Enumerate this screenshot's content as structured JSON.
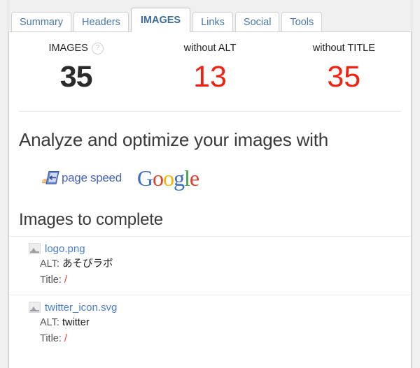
{
  "tabs": [
    {
      "label": "Summary",
      "active": false
    },
    {
      "label": "Headers",
      "active": false
    },
    {
      "label": "IMAGES",
      "active": true
    },
    {
      "label": "Links",
      "active": false
    },
    {
      "label": "Social",
      "active": false
    },
    {
      "label": "Tools",
      "active": false
    }
  ],
  "stats": [
    {
      "label": "IMAGES",
      "value": "35",
      "color": "#2b2b2b",
      "has_help": true,
      "help_glyph": "?"
    },
    {
      "label": "without ALT",
      "value": "13",
      "color": "#f02211",
      "has_help": false
    },
    {
      "label": "without TITLE",
      "value": "35",
      "color": "#f02211",
      "has_help": false
    }
  ],
  "analyze": {
    "title": "Analyze and optimize your images with",
    "pagespeed_label": "page speed",
    "google_letters": [
      {
        "ch": "G",
        "color": "#3b6ec4"
      },
      {
        "ch": "o",
        "color": "#dd3f2c"
      },
      {
        "ch": "o",
        "color": "#f2b600"
      },
      {
        "ch": "g",
        "color": "#3b6ec4"
      },
      {
        "ch": "l",
        "color": "#35a043"
      },
      {
        "ch": "e",
        "color": "#dd3f2c"
      }
    ]
  },
  "images_section": {
    "title": "Images to complete",
    "alt_key": "ALT:",
    "title_key": "Title:",
    "items": [
      {
        "name": "logo.png",
        "alt": "あそびラボ",
        "title": "/"
      },
      {
        "name": "twitter_icon.svg",
        "alt": "twitter",
        "title": "/"
      }
    ]
  }
}
